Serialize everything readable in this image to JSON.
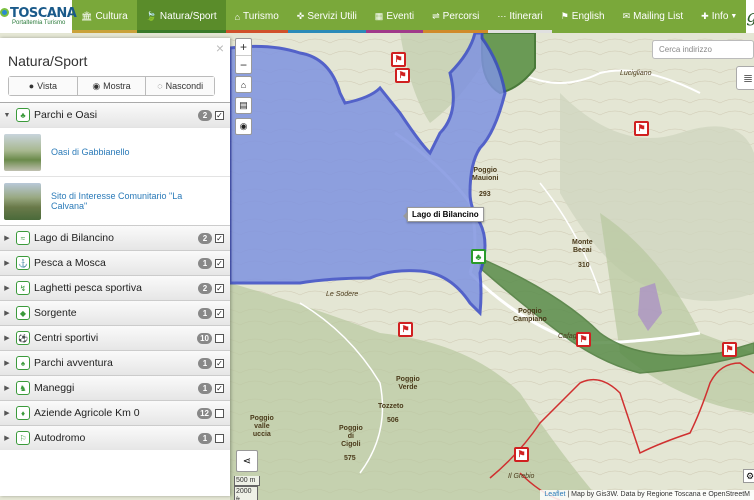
{
  "brand": {
    "title": "TOSCANA",
    "subtitle": "Portaltemia Turismo"
  },
  "nav": {
    "items": [
      {
        "label": "Cultura",
        "icon": "bank-icon"
      },
      {
        "label": "Natura/Sport",
        "icon": "leaf-icon"
      },
      {
        "label": "Turismo",
        "icon": "home-icon"
      },
      {
        "label": "Servizi Utili",
        "icon": "wrench-icon"
      },
      {
        "label": "Eventi",
        "icon": "calendar-icon"
      },
      {
        "label": "Percorsi",
        "icon": "signpost-icon"
      },
      {
        "label": "Itinerari",
        "icon": "route-icon"
      }
    ],
    "right": [
      {
        "label": "English",
        "icon": "flag-icon"
      },
      {
        "label": "Mailing List",
        "icon": "envelope-icon"
      },
      {
        "label": "Info",
        "icon": "plus-icon"
      }
    ],
    "gis_logo": "gis"
  },
  "sidebar": {
    "title": "Natura/Sport",
    "close": "×",
    "buttons": [
      {
        "label": "Vista",
        "icon": "globe-icon"
      },
      {
        "label": "Mostra",
        "icon": "eye-icon"
      },
      {
        "label": "Nascondi",
        "icon": "eye-slash-icon"
      }
    ],
    "expanded": {
      "label": "Parchi e Oasi",
      "count": "2",
      "checked": "✓",
      "pois": [
        {
          "name": "Oasi di Gabbianello"
        },
        {
          "name": "Sito di Interesse Comunitario \"La Calvana\""
        }
      ]
    },
    "categories": [
      {
        "label": "Lago di Bilancino",
        "count": "2",
        "checked": "✓"
      },
      {
        "label": "Pesca a Mosca",
        "count": "1",
        "checked": "✓"
      },
      {
        "label": "Laghetti pesca sportiva",
        "count": "2",
        "checked": "✓"
      },
      {
        "label": "Sorgente",
        "count": "1",
        "checked": "✓"
      },
      {
        "label": "Centri sportivi",
        "count": "10",
        "checked": ""
      },
      {
        "label": "Parchi avventura",
        "count": "1",
        "checked": "✓"
      },
      {
        "label": "Maneggi",
        "count": "1",
        "checked": "✓"
      },
      {
        "label": "Aziende Agricole Km 0",
        "count": "12",
        "checked": ""
      },
      {
        "label": "Autodromo",
        "count": "1",
        "checked": ""
      }
    ]
  },
  "map": {
    "search_placeholder": "Cerca indirizzo",
    "tooltip": "Lago di Bilancino",
    "labels": {
      "lucigliano": "Lucigliano",
      "poggio_mauioni": "Poggio\nMauioni",
      "monte_becai": "Monte\nBecai",
      "le_sodere": "Le Sodere",
      "poggio_campiano": "Poggio\nCampiano",
      "cafag": "Cafag",
      "poggio_verde": "Poggio\nVerde",
      "tozzeto": "Tozzeto",
      "poggio_di_cigoli": "Poggio\ndi\nCigoli",
      "poggio_valle_uccia": "Poggio\nvalle\nuccia",
      "il_grebio": "Il Grebio",
      "h293": "293",
      "h310": "310",
      "h506": "506",
      "h575": "575"
    },
    "scale": {
      "metric": "500 m",
      "imperial": "2000 ft"
    },
    "attribution": {
      "leaflet": "Leaflet",
      "text": " | Map by Gis3W. Data by Regione Toscana e OpenStreetM"
    }
  },
  "colors": {
    "nav": "#7aa83a",
    "lake": "#7f93e0",
    "lake_border": "#3a4cc8",
    "park": "#5a8c4a",
    "trail": "#d03030"
  }
}
